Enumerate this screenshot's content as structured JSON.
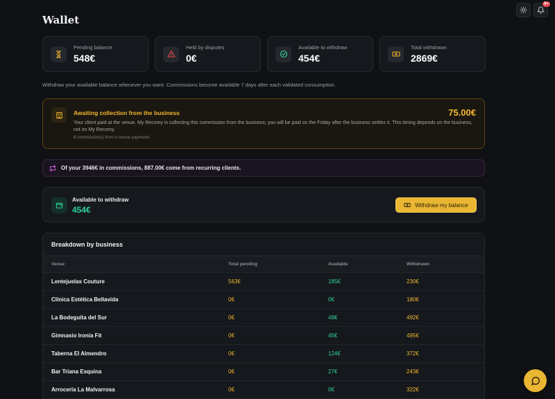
{
  "header": {
    "title": "Wallet",
    "notification_count": "9+"
  },
  "stats": [
    {
      "label": "Pending balance",
      "value": "548€",
      "icon": "hourglass-icon"
    },
    {
      "label": "Held by disputes",
      "value": "0€",
      "icon": "warning-triangle-icon"
    },
    {
      "label": "Available to withdraw",
      "value": "454€",
      "icon": "check-circle-icon"
    },
    {
      "label": "Total withdrawn",
      "value": "2869€",
      "icon": "banknote-icon"
    }
  ],
  "intro_text": "Withdraw your available balance whenever you want. Commissions become available 7 days after each validated consumption.",
  "awaiting": {
    "title": "Awaiting collection from the business",
    "amount": "75.00€",
    "description": "Your client paid at the venue. My Recomy is collecting this commission from the business; you will be paid on the Friday after the business settles it. This timing depends on the business, not on My Recomy.",
    "note": "8 commission(s) from in-venue payments"
  },
  "recurring_text": "Of your 3946€ in commissions, 887.00€ come from recurring clients.",
  "withdraw": {
    "label": "Available to withdraw",
    "amount": "454€",
    "button_label": "Withdraw my balance"
  },
  "breakdown": {
    "title": "Breakdown by business",
    "columns": [
      "Venue",
      "Total pending",
      "Available",
      "Withdrawn"
    ],
    "rows": [
      {
        "venue": "Lentejuelas Couture",
        "pending": "563€",
        "available": "185€",
        "withdrawn": "230€"
      },
      {
        "venue": "Clínica Estética Bellavida",
        "pending": "0€",
        "available": "0€",
        "withdrawn": "180€"
      },
      {
        "venue": "La Bodeguita del Sur",
        "pending": "0€",
        "available": "48€",
        "withdrawn": "492€"
      },
      {
        "venue": "Gimnasio Ironia Fit",
        "pending": "0€",
        "available": "45€",
        "withdrawn": "495€"
      },
      {
        "venue": "Taberna El Almendro",
        "pending": "0€",
        "available": "124€",
        "withdrawn": "372€"
      },
      {
        "venue": "Bar Triana Esquina",
        "pending": "0€",
        "available": "27€",
        "withdrawn": "243€"
      },
      {
        "venue": "Arrocería La Malvarrosa",
        "pending": "0€",
        "available": "0€",
        "withdrawn": "322€"
      }
    ]
  },
  "colors": {
    "accent": "#f5b72e",
    "positive": "#2fd39a",
    "background": "#0f1114"
  }
}
